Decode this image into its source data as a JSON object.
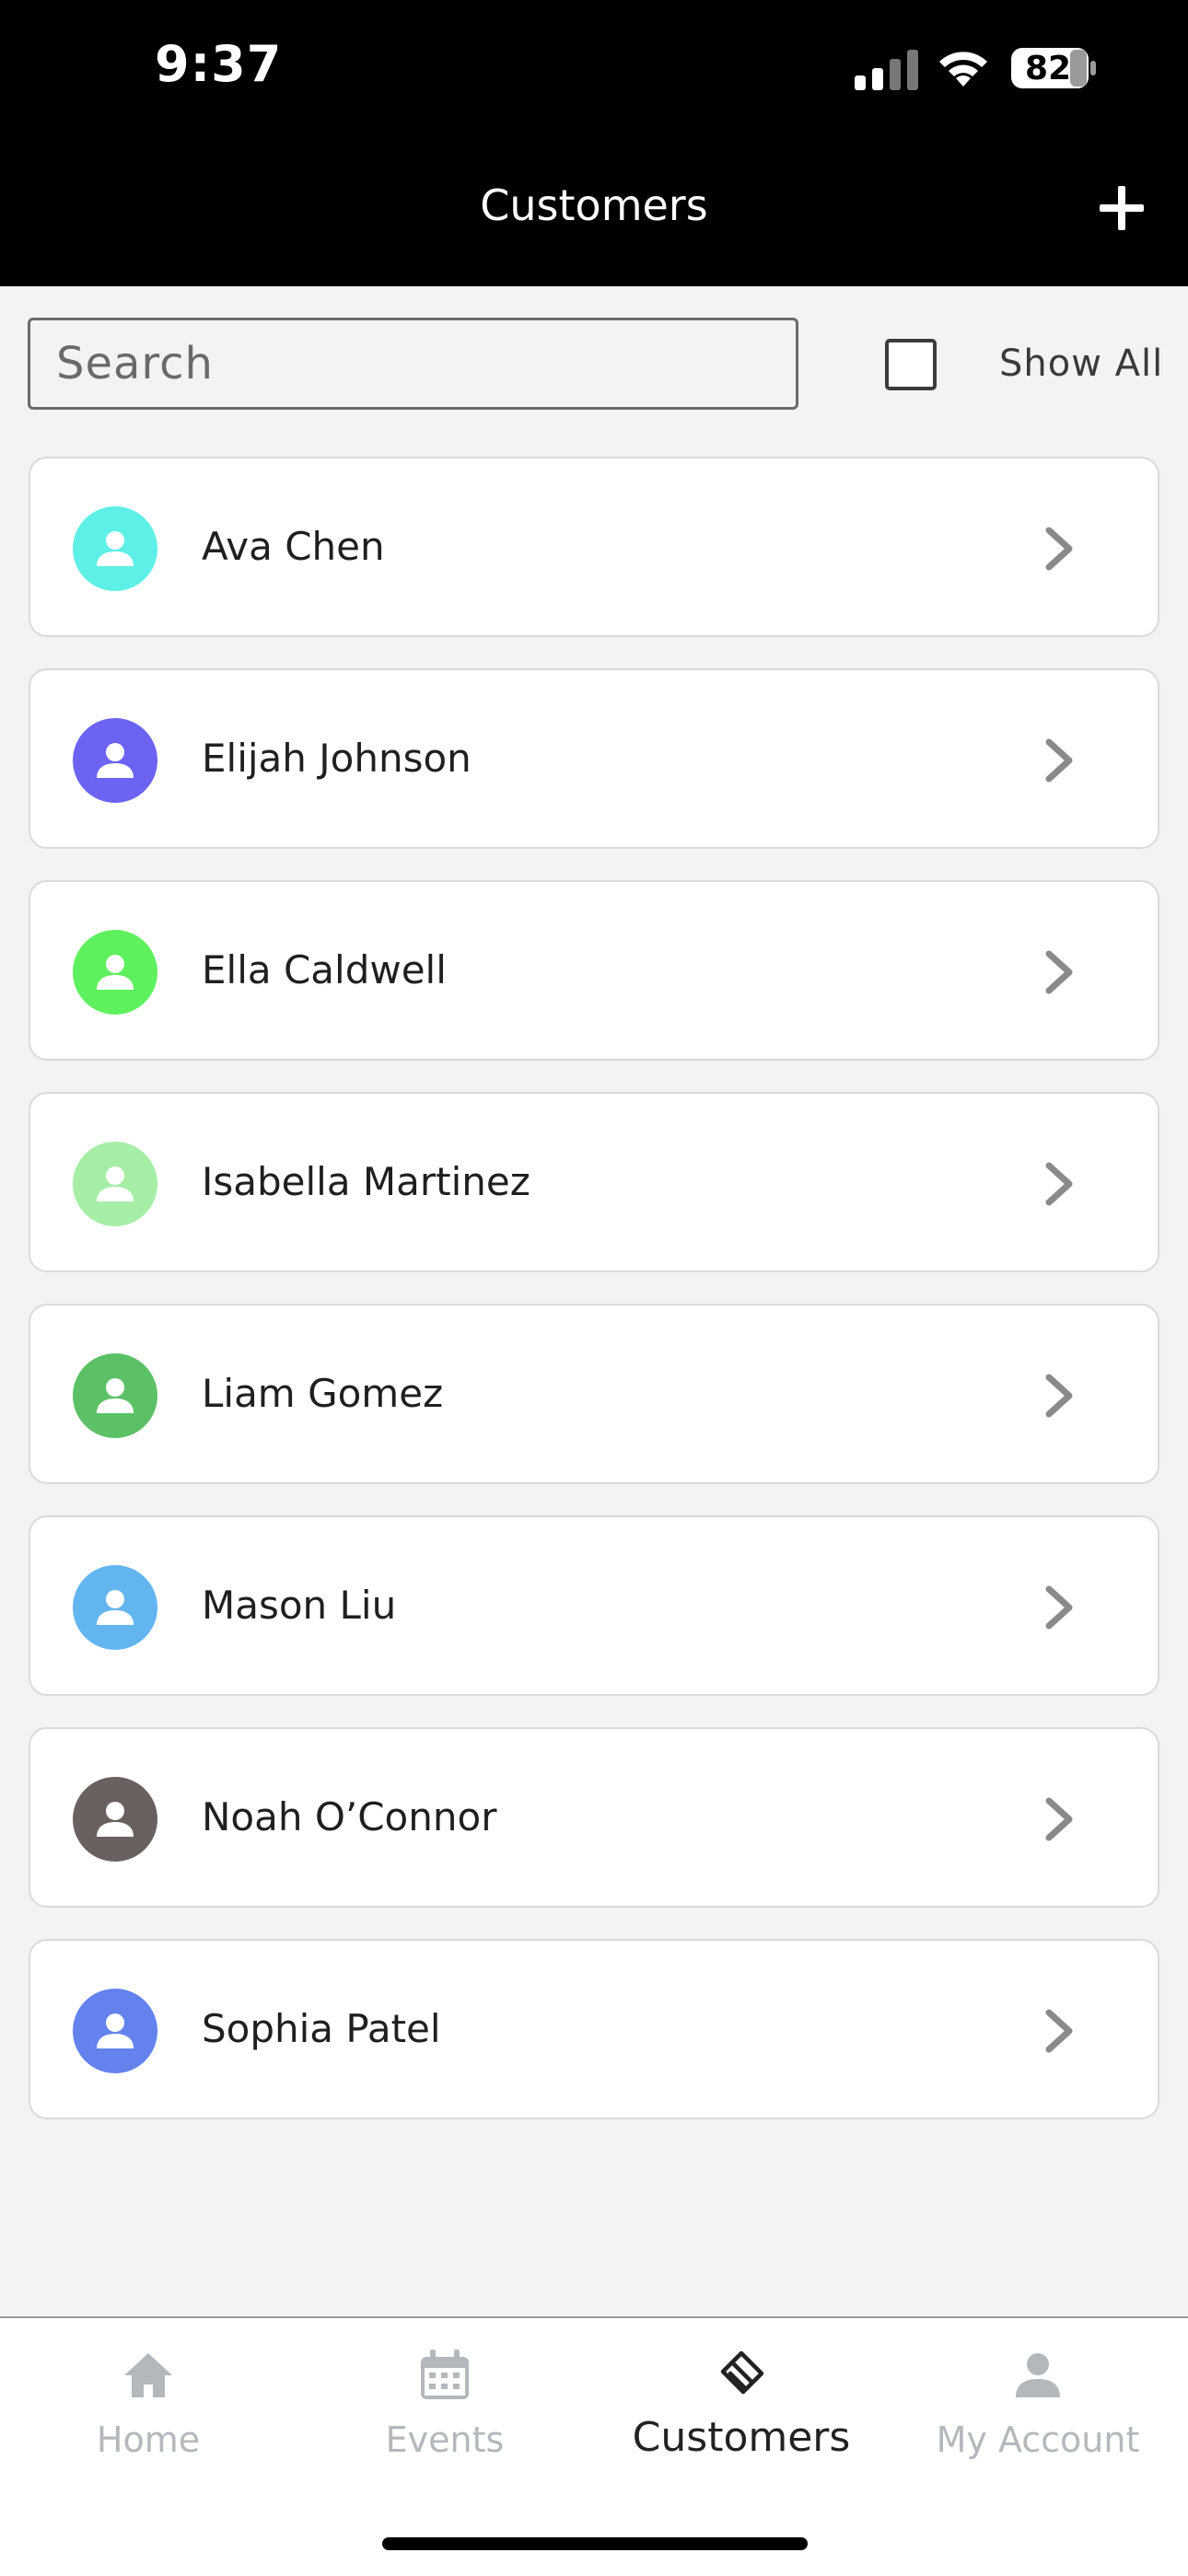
{
  "status_bar": {
    "time": "9:37",
    "battery": "82",
    "icons": [
      "cellular-signal-icon",
      "wifi-icon",
      "battery-icon"
    ]
  },
  "header": {
    "title": "Customers",
    "add_icon": "plus-icon"
  },
  "search": {
    "placeholder": "Search",
    "value": ""
  },
  "show_all": {
    "label": "Show All",
    "checked": false
  },
  "customers": [
    {
      "name": "Ava Chen",
      "avatar_color": "#5ef0e6"
    },
    {
      "name": "Elijah Johnson",
      "avatar_color": "#6b63f2"
    },
    {
      "name": "Ella Caldwell",
      "avatar_color": "#5ef05e"
    },
    {
      "name": "Isabella Martinez",
      "avatar_color": "#a6eea6"
    },
    {
      "name": "Liam Gomez",
      "avatar_color": "#5cc166"
    },
    {
      "name": "Mason Liu",
      "avatar_color": "#63b5f0"
    },
    {
      "name": "Noah O’Connor",
      "avatar_color": "#6a6060"
    },
    {
      "name": "Sophia Patel",
      "avatar_color": "#6382ee"
    }
  ],
  "bottom_nav": {
    "items": [
      {
        "label": "Home",
        "icon": "home-icon",
        "active": false
      },
      {
        "label": "Events",
        "icon": "calendar-icon",
        "active": false
      },
      {
        "label": "Customers",
        "icon": "handshake-icon",
        "active": true
      },
      {
        "label": "My Account",
        "icon": "person-icon",
        "active": false
      }
    ]
  },
  "colors": {
    "header_bg": "#000000",
    "page_bg": "#f3f3f3",
    "nav_inactive": "#b3b8bd",
    "nav_active": "#222222",
    "chevron": "#8a8a8a"
  }
}
